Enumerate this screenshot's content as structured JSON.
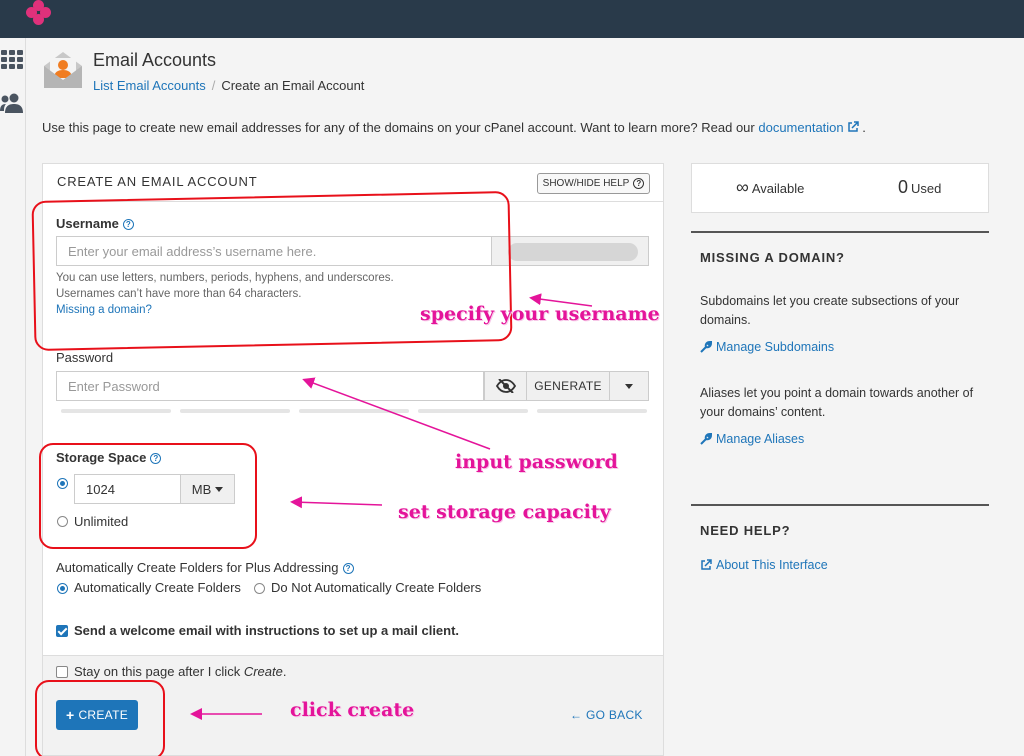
{
  "brand": {
    "accent": "#1e75b9",
    "topbar": "#293a4a",
    "annotation_color": "#e4149a",
    "box_color": "#e8101a"
  },
  "header": {
    "title": "Email Accounts",
    "breadcrumb": {
      "link": "List Email Accounts",
      "separator": "/",
      "current": "Create an Email Account"
    }
  },
  "intro": {
    "text": "Use this page to create new email addresses for any of the domains on your cPanel account. Want to learn more? Read our ",
    "link": "documentation",
    "suffix": " ."
  },
  "form": {
    "title": "CREATE AN EMAIL ACCOUNT",
    "help_button": "SHOW/HIDE HELP",
    "username": {
      "label": "Username",
      "placeholder": "Enter your email address’s username here.",
      "hint1": "You can use letters, numbers, periods, hyphens, and underscores.",
      "hint2": "Usernames can’t have more than 64 characters.",
      "missing_link": "Missing a domain?"
    },
    "password": {
      "label": "Password",
      "placeholder": "Enter Password",
      "generate": "GENERATE"
    },
    "storage": {
      "label": "Storage Space",
      "value": "1024",
      "unit": "MB",
      "unlimited": "Unlimited",
      "selected": "custom"
    },
    "plus_addressing": {
      "label": "Automatically Create Folders for Plus Addressing",
      "opt_auto": "Automatically Create Folders",
      "opt_none": "Do Not Automatically Create Folders",
      "selected": "auto"
    },
    "welcome": {
      "label": "Send a welcome email with instructions to set up a mail client.",
      "checked": true
    },
    "stay": {
      "label_pre": "Stay on this page after I click ",
      "label_em": "Create",
      "label_post": ".",
      "checked": false
    },
    "create_button": "CREATE",
    "go_back": "GO BACK"
  },
  "stats": {
    "available_symbol": "∞",
    "available_label": "Available",
    "used_value": "0",
    "used_label": "Used"
  },
  "sidebar": {
    "missing_domain": {
      "title": "MISSING A DOMAIN?",
      "sub_text": "Subdomains let you create subsections of your domains.",
      "sub_link": "Manage Subdomains",
      "alias_text": "Aliases let you point a domain towards another of your domains’ content.",
      "alias_link": "Manage Aliases"
    },
    "need_help": {
      "title": "NEED HELP?",
      "link": "About This Interface"
    }
  },
  "annotations": {
    "username": "specify your username",
    "password": "input password",
    "storage": "set storage capacity",
    "create": "click create"
  },
  "icons": {
    "help": "?",
    "wrench": "wrench-icon",
    "external": "external-link-icon",
    "eye": "eye-slash-icon",
    "plus": "+",
    "back": "←"
  }
}
